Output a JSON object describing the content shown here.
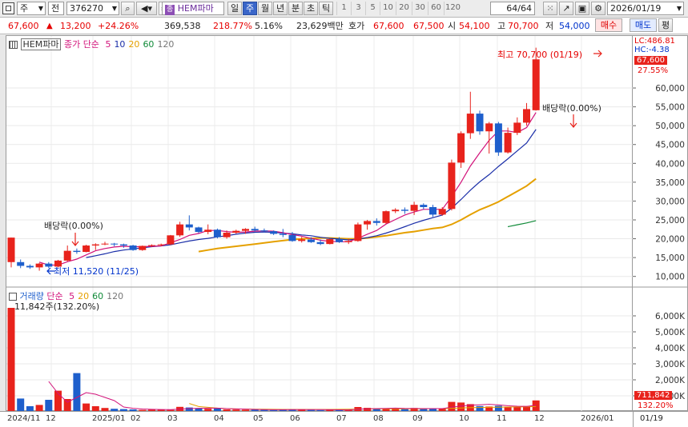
{
  "toolbar": {
    "market_label": "주",
    "all_label": "전",
    "code": "376270",
    "stock_badge": "종",
    "stock_name": "HEM파마",
    "periods": [
      "일",
      "주",
      "월",
      "년",
      "분",
      "초",
      "틱"
    ],
    "selected_period": "주",
    "intervals": [
      "1",
      "3",
      "5",
      "10",
      "20",
      "30",
      "60",
      "120"
    ],
    "count": "64",
    "count_total": "/64",
    "date": "2026/01/19"
  },
  "quote": {
    "price": "67,600",
    "change": "13,200",
    "change_pct": "+24.26%",
    "volume": "369,538",
    "vol_ratio": "218.77%",
    "turnover": "5.16%",
    "amount": "23,629백만",
    "hoga_label": "호가",
    "ask": "67,600",
    "bid": "67,500",
    "open_label": "시",
    "open": "54,100",
    "high_label": "고",
    "high": "70,700",
    "low_label": "저",
    "low": "54,000",
    "buy_label": "매수",
    "sell_label": "매도",
    "eval_label": "평"
  },
  "price_panel": {
    "legend_name": "HEM파마",
    "legend_type": "종가 단순",
    "ma": [
      "5",
      "10",
      "20",
      "60",
      "120"
    ],
    "ma_colors": [
      "#d2127a",
      "#1a2ea8",
      "#e5a000",
      "#108a38",
      "#777777"
    ],
    "lc": "LC:486.81",
    "hc": "HC:-4.38",
    "last_price": "67,600",
    "pct_tag": "27.55%",
    "high_annot": "최고 70,700 (01/19)",
    "low_annot": "최저 11,520 (11/25)",
    "dividend1": "배당락(0.00%)",
    "dividend2": "배당락(0.00%)"
  },
  "volume_panel": {
    "legend_name": "거래량",
    "legend_type": "단순",
    "ma": [
      "5",
      "20",
      "60",
      "120"
    ],
    "info": "11,842주(132.20%)",
    "last_volume": "711,842",
    "pct_tag": "132.20%"
  },
  "x_labels": [
    "2024/11",
    "12",
    "2025/01",
    "02",
    "03",
    "04",
    "05",
    "06",
    "07",
    "08",
    "09",
    "10",
    "11",
    "12",
    "2026/01"
  ],
  "x_cursor": "01/19",
  "colors": {
    "up": "#e8231c",
    "down": "#1e5fcc",
    "tag": "#e8231c"
  },
  "chart_data": {
    "type": "candlestick",
    "unit": "weekly",
    "y_ticks": [
      10000,
      15000,
      20000,
      25000,
      30000,
      35000,
      40000,
      45000,
      50000,
      55000,
      60000
    ],
    "y_tick_labels": [
      "10,000",
      "15,000",
      "20,000",
      "25,000",
      "30,000",
      "35,000",
      "40,000",
      "45,000",
      "50,000",
      "55,000",
      "60,000"
    ],
    "ylim": [
      7600,
      73800
    ],
    "candles": [
      {
        "o": 13800,
        "h": 20300,
        "l": 12400,
        "c": 20300
      },
      {
        "o": 13800,
        "h": 14500,
        "l": 12200,
        "c": 12800
      },
      {
        "o": 12800,
        "h": 13200,
        "l": 12000,
        "c": 12400
      },
      {
        "o": 12400,
        "h": 13600,
        "l": 11520,
        "c": 13400
      },
      {
        "o": 13400,
        "h": 13800,
        "l": 12200,
        "c": 12600
      },
      {
        "o": 12600,
        "h": 14400,
        "l": 12400,
        "c": 14200
      },
      {
        "o": 14200,
        "h": 18200,
        "l": 14000,
        "c": 16800
      },
      {
        "o": 16800,
        "h": 17400,
        "l": 16000,
        "c": 16500
      },
      {
        "o": 16500,
        "h": 18400,
        "l": 16400,
        "c": 18200
      },
      {
        "o": 18200,
        "h": 18800,
        "l": 17000,
        "c": 18500
      },
      {
        "o": 18500,
        "h": 19200,
        "l": 18300,
        "c": 18700
      },
      {
        "o": 18700,
        "h": 18900,
        "l": 18000,
        "c": 18500
      },
      {
        "o": 18500,
        "h": 18700,
        "l": 17600,
        "c": 18200
      },
      {
        "o": 18200,
        "h": 18400,
        "l": 16800,
        "c": 17000
      },
      {
        "o": 17000,
        "h": 18200,
        "l": 16800,
        "c": 18100
      },
      {
        "o": 18100,
        "h": 18500,
        "l": 17800,
        "c": 18300
      },
      {
        "o": 18300,
        "h": 18700,
        "l": 18000,
        "c": 18500
      },
      {
        "o": 18500,
        "h": 21000,
        "l": 18300,
        "c": 20900
      },
      {
        "o": 20900,
        "h": 24500,
        "l": 20500,
        "c": 23800
      },
      {
        "o": 23800,
        "h": 26200,
        "l": 22200,
        "c": 23000
      },
      {
        "o": 23000,
        "h": 23200,
        "l": 21500,
        "c": 21800
      },
      {
        "o": 21800,
        "h": 23800,
        "l": 21200,
        "c": 22400
      },
      {
        "o": 22400,
        "h": 22700,
        "l": 20100,
        "c": 20400
      },
      {
        "o": 20400,
        "h": 22200,
        "l": 20000,
        "c": 21600
      },
      {
        "o": 21600,
        "h": 22400,
        "l": 21300,
        "c": 22100
      },
      {
        "o": 22100,
        "h": 22800,
        "l": 21300,
        "c": 22600
      },
      {
        "o": 22600,
        "h": 23200,
        "l": 21900,
        "c": 22200
      },
      {
        "o": 22200,
        "h": 22700,
        "l": 21700,
        "c": 22000
      },
      {
        "o": 22000,
        "h": 22200,
        "l": 21000,
        "c": 21300
      },
      {
        "o": 21300,
        "h": 22600,
        "l": 20400,
        "c": 21000
      },
      {
        "o": 21000,
        "h": 21800,
        "l": 19200,
        "c": 19400
      },
      {
        "o": 19400,
        "h": 20500,
        "l": 19000,
        "c": 19800
      },
      {
        "o": 19800,
        "h": 20400,
        "l": 18900,
        "c": 19100
      },
      {
        "o": 19100,
        "h": 19800,
        "l": 18300,
        "c": 18600
      },
      {
        "o": 18600,
        "h": 20000,
        "l": 18500,
        "c": 19900
      },
      {
        "o": 19900,
        "h": 20400,
        "l": 18900,
        "c": 19100
      },
      {
        "o": 19100,
        "h": 20000,
        "l": 18600,
        "c": 19400
      },
      {
        "o": 19400,
        "h": 24300,
        "l": 19200,
        "c": 23800
      },
      {
        "o": 23800,
        "h": 25000,
        "l": 22400,
        "c": 24700
      },
      {
        "o": 24700,
        "h": 25400,
        "l": 23500,
        "c": 24200
      },
      {
        "o": 24200,
        "h": 27500,
        "l": 23900,
        "c": 27300
      },
      {
        "o": 27300,
        "h": 28100,
        "l": 26800,
        "c": 27700
      },
      {
        "o": 27700,
        "h": 28300,
        "l": 26600,
        "c": 27400
      },
      {
        "o": 27400,
        "h": 29800,
        "l": 26300,
        "c": 29000
      },
      {
        "o": 29000,
        "h": 29400,
        "l": 27800,
        "c": 28400
      },
      {
        "o": 28400,
        "h": 29000,
        "l": 25800,
        "c": 26400
      },
      {
        "o": 26400,
        "h": 28400,
        "l": 26100,
        "c": 27900
      },
      {
        "o": 27900,
        "h": 41000,
        "l": 27500,
        "c": 40200
      },
      {
        "o": 40200,
        "h": 48500,
        "l": 38800,
        "c": 48000
      },
      {
        "o": 48000,
        "h": 59000,
        "l": 46500,
        "c": 53200
      },
      {
        "o": 53200,
        "h": 54000,
        "l": 47600,
        "c": 48500
      },
      {
        "o": 48500,
        "h": 51000,
        "l": 42600,
        "c": 50600
      },
      {
        "o": 50600,
        "h": 51000,
        "l": 42000,
        "c": 42900
      },
      {
        "o": 42900,
        "h": 49500,
        "l": 42600,
        "c": 48100
      },
      {
        "o": 48100,
        "h": 52200,
        "l": 47500,
        "c": 50800
      },
      {
        "o": 50800,
        "h": 56000,
        "l": 50000,
        "c": 54400
      },
      {
        "o": 54100,
        "h": 70700,
        "l": 54000,
        "c": 67600
      }
    ],
    "ma5": [
      [
        3,
        13800
      ],
      [
        4,
        13000
      ],
      [
        5,
        13000
      ],
      [
        6,
        13900
      ],
      [
        7,
        14600
      ],
      [
        8,
        15700
      ],
      [
        9,
        16800
      ],
      [
        10,
        17400
      ],
      [
        11,
        17800
      ],
      [
        12,
        18000
      ],
      [
        13,
        17900
      ],
      [
        14,
        17900
      ],
      [
        15,
        18000
      ],
      [
        16,
        18100
      ],
      [
        17,
        18900
      ],
      [
        18,
        19800
      ],
      [
        19,
        20900
      ],
      [
        20,
        21400
      ],
      [
        21,
        22200
      ],
      [
        22,
        22200
      ],
      [
        23,
        21900
      ],
      [
        24,
        21700
      ],
      [
        25,
        21800
      ],
      [
        26,
        22000
      ],
      [
        27,
        22100
      ],
      [
        28,
        22000
      ],
      [
        29,
        21600
      ],
      [
        30,
        21100
      ],
      [
        31,
        20700
      ],
      [
        32,
        20100
      ],
      [
        33,
        19600
      ],
      [
        34,
        19300
      ],
      [
        35,
        19200
      ],
      [
        36,
        19200
      ],
      [
        37,
        20100
      ],
      [
        38,
        21200
      ],
      [
        39,
        22200
      ],
      [
        40,
        23900
      ],
      [
        41,
        25100
      ],
      [
        42,
        26300
      ],
      [
        43,
        27100
      ],
      [
        44,
        27800
      ],
      [
        45,
        27800
      ],
      [
        46,
        27800
      ],
      [
        47,
        31200
      ],
      [
        48,
        35000
      ],
      [
        49,
        39300
      ],
      [
        50,
        42800
      ],
      [
        51,
        46100
      ],
      [
        52,
        48600
      ],
      [
        53,
        48600
      ],
      [
        54,
        48200
      ],
      [
        55,
        49500
      ],
      [
        56,
        53500
      ]
    ],
    "ma10": [
      [
        8,
        15000
      ],
      [
        9,
        15500
      ],
      [
        10,
        16000
      ],
      [
        11,
        16600
      ],
      [
        12,
        17000
      ],
      [
        13,
        17300
      ],
      [
        14,
        17600
      ],
      [
        15,
        17900
      ],
      [
        16,
        18100
      ],
      [
        17,
        18400
      ],
      [
        18,
        18900
      ],
      [
        19,
        19400
      ],
      [
        20,
        19800
      ],
      [
        21,
        20100
      ],
      [
        22,
        20500
      ],
      [
        23,
        20800
      ],
      [
        24,
        21200
      ],
      [
        25,
        21500
      ],
      [
        26,
        21700
      ],
      [
        27,
        21800
      ],
      [
        28,
        21700
      ],
      [
        29,
        21500
      ],
      [
        30,
        21300
      ],
      [
        31,
        21000
      ],
      [
        32,
        20800
      ],
      [
        33,
        20400
      ],
      [
        34,
        20100
      ],
      [
        35,
        19900
      ],
      [
        36,
        19700
      ],
      [
        37,
        19900
      ],
      [
        38,
        20300
      ],
      [
        39,
        20800
      ],
      [
        40,
        21500
      ],
      [
        41,
        22300
      ],
      [
        42,
        23200
      ],
      [
        43,
        24100
      ],
      [
        44,
        24900
      ],
      [
        45,
        25600
      ],
      [
        46,
        26300
      ],
      [
        47,
        28100
      ],
      [
        48,
        30400
      ],
      [
        49,
        32900
      ],
      [
        50,
        35100
      ],
      [
        51,
        37000
      ],
      [
        52,
        39200
      ],
      [
        53,
        41200
      ],
      [
        54,
        43300
      ],
      [
        55,
        45400
      ],
      [
        56,
        49000
      ]
    ],
    "ma20": [
      [
        20,
        16600
      ],
      [
        21,
        17000
      ],
      [
        22,
        17400
      ],
      [
        23,
        17700
      ],
      [
        24,
        18000
      ],
      [
        25,
        18300
      ],
      [
        26,
        18600
      ],
      [
        27,
        18900
      ],
      [
        28,
        19200
      ],
      [
        29,
        19500
      ],
      [
        30,
        19800
      ],
      [
        31,
        20000
      ],
      [
        32,
        20100
      ],
      [
        33,
        20200
      ],
      [
        34,
        20200
      ],
      [
        35,
        20100
      ],
      [
        36,
        20000
      ],
      [
        37,
        20000
      ],
      [
        38,
        20200
      ],
      [
        39,
        20500
      ],
      [
        40,
        20800
      ],
      [
        41,
        21200
      ],
      [
        42,
        21600
      ],
      [
        43,
        21900
      ],
      [
        44,
        22300
      ],
      [
        45,
        22700
      ],
      [
        46,
        23000
      ],
      [
        47,
        23800
      ],
      [
        48,
        25000
      ],
      [
        49,
        26400
      ],
      [
        50,
        27700
      ],
      [
        51,
        28700
      ],
      [
        52,
        29800
      ],
      [
        53,
        31200
      ],
      [
        54,
        32600
      ],
      [
        55,
        34000
      ],
      [
        56,
        35900
      ]
    ],
    "ma60": [
      [
        53,
        23200
      ],
      [
        54,
        23700
      ],
      [
        55,
        24200
      ],
      [
        56,
        24800
      ]
    ],
    "volume_ylim": [
      0,
      7000000
    ],
    "volume_ticks": [
      1000000,
      2000000,
      3000000,
      4000000,
      5000000,
      6000000
    ],
    "volume_tick_labels": [
      "1,000K",
      "2,000K",
      "3,000K",
      "4,000K",
      "5,000K",
      "6,000K"
    ],
    "volumes": [
      6500000,
      830000,
      350000,
      430000,
      750000,
      1320000,
      800000,
      2420000,
      520000,
      350000,
      240000,
      190000,
      170000,
      150000,
      120000,
      140000,
      130000,
      120000,
      310000,
      270000,
      200000,
      190000,
      210000,
      150000,
      140000,
      130000,
      130000,
      120000,
      110000,
      130000,
      160000,
      140000,
      120000,
      110000,
      130000,
      120000,
      110000,
      300000,
      250000,
      200000,
      220000,
      180000,
      170000,
      240000,
      200000,
      190000,
      180000,
      620000,
      580000,
      480000,
      360000,
      330000,
      380000,
      320000,
      300000,
      360000,
      711842
    ],
    "vma5": [
      [
        4,
        1900000
      ],
      [
        5,
        1150000
      ],
      [
        6,
        600000
      ],
      [
        7,
        900000
      ],
      [
        8,
        1200000
      ],
      [
        9,
        1100000
      ],
      [
        10,
        900000
      ],
      [
        11,
        700000
      ],
      [
        12,
        300000
      ],
      [
        13,
        220000
      ],
      [
        14,
        175000
      ],
      [
        15,
        155000
      ],
      [
        16,
        145000
      ],
      [
        17,
        140000
      ],
      [
        18,
        170000
      ],
      [
        19,
        200000
      ],
      [
        20,
        220000
      ],
      [
        21,
        230000
      ],
      [
        22,
        230000
      ],
      [
        23,
        200000
      ],
      [
        24,
        180000
      ],
      [
        25,
        170000
      ],
      [
        26,
        150000
      ],
      [
        27,
        140000
      ],
      [
        28,
        130000
      ],
      [
        29,
        130000
      ],
      [
        30,
        135000
      ],
      [
        31,
        140000
      ],
      [
        32,
        140000
      ],
      [
        33,
        135000
      ],
      [
        34,
        130000
      ],
      [
        35,
        125000
      ],
      [
        36,
        120000
      ],
      [
        37,
        160000
      ],
      [
        38,
        190000
      ],
      [
        39,
        200000
      ],
      [
        40,
        215000
      ],
      [
        41,
        230000
      ],
      [
        42,
        210000
      ],
      [
        43,
        205000
      ],
      [
        44,
        200000
      ],
      [
        45,
        200000
      ],
      [
        46,
        200000
      ],
      [
        47,
        290000
      ],
      [
        48,
        360000
      ],
      [
        49,
        410000
      ],
      [
        50,
        440000
      ],
      [
        51,
        470000
      ],
      [
        52,
        430000
      ],
      [
        53,
        380000
      ],
      [
        54,
        350000
      ],
      [
        55,
        340000
      ],
      [
        56,
        410000
      ]
    ],
    "vma20": [
      [
        19,
        520000
      ],
      [
        20,
        330000
      ],
      [
        21,
        280000
      ],
      [
        22,
        230000
      ],
      [
        23,
        200000
      ],
      [
        24,
        180000
      ],
      [
        25,
        170000
      ],
      [
        26,
        165000
      ],
      [
        27,
        160000
      ],
      [
        28,
        155000
      ],
      [
        29,
        150000
      ],
      [
        30,
        150000
      ],
      [
        31,
        150000
      ],
      [
        32,
        150000
      ],
      [
        33,
        150000
      ],
      [
        34,
        150000
      ],
      [
        35,
        155000
      ],
      [
        36,
        160000
      ],
      [
        37,
        170000
      ],
      [
        38,
        180000
      ],
      [
        39,
        185000
      ],
      [
        40,
        190000
      ],
      [
        41,
        190000
      ],
      [
        42,
        190000
      ],
      [
        43,
        190000
      ],
      [
        44,
        190000
      ],
      [
        45,
        200000
      ],
      [
        46,
        200000
      ],
      [
        47,
        220000
      ],
      [
        48,
        240000
      ],
      [
        49,
        260000
      ],
      [
        50,
        270000
      ],
      [
        51,
        280000
      ],
      [
        52,
        290000
      ],
      [
        53,
        300000
      ],
      [
        54,
        305000
      ],
      [
        55,
        310000
      ],
      [
        56,
        330000
      ]
    ]
  }
}
